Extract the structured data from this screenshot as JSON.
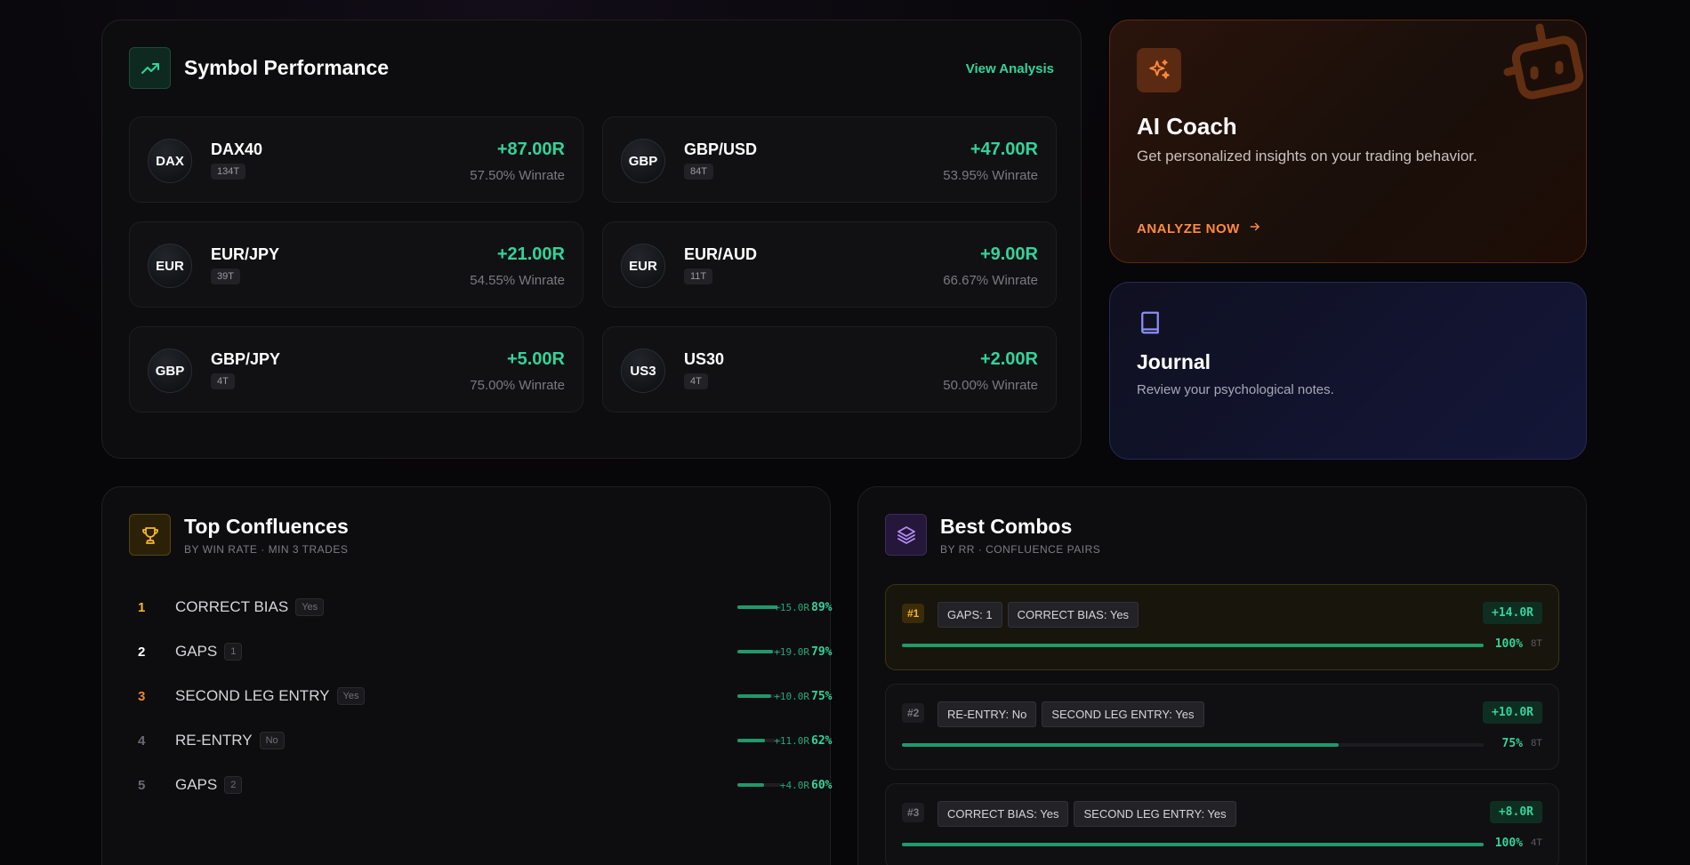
{
  "symbol_performance": {
    "title": "Symbol Performance",
    "view_link": "View Analysis",
    "symbols": [
      {
        "badge": "DAX",
        "name": "DAX40",
        "trades": "134T",
        "r": "+87.00R",
        "winrate": "57.50% Winrate"
      },
      {
        "badge": "GBP",
        "name": "GBP/USD",
        "trades": "84T",
        "r": "+47.00R",
        "winrate": "53.95% Winrate"
      },
      {
        "badge": "EUR",
        "name": "EUR/JPY",
        "trades": "39T",
        "r": "+21.00R",
        "winrate": "54.55% Winrate"
      },
      {
        "badge": "EUR",
        "name": "EUR/AUD",
        "trades": "11T",
        "r": "+9.00R",
        "winrate": "66.67% Winrate"
      },
      {
        "badge": "GBP",
        "name": "GBP/JPY",
        "trades": "4T",
        "r": "+5.00R",
        "winrate": "75.00% Winrate"
      },
      {
        "badge": "US3",
        "name": "US30",
        "trades": "4T",
        "r": "+2.00R",
        "winrate": "50.00% Winrate"
      }
    ]
  },
  "ai_coach": {
    "title": "AI Coach",
    "description": "Get personalized insights on your trading behavior.",
    "cta": "ANALYZE NOW",
    "accent": "#ff8a3d"
  },
  "journal": {
    "title": "Journal",
    "description": "Review your psychological notes."
  },
  "top_confluences": {
    "title": "Top Confluences",
    "subtitle": "BY WIN RATE · MIN 3 TRADES",
    "rows": [
      {
        "rank": "1",
        "rank_color": "#f5b52a",
        "name": "CORRECT BIAS",
        "tag": "Yes",
        "fill": 0.89,
        "pct": "89%",
        "r": "+15.0R"
      },
      {
        "rank": "2",
        "rank_color": "#ffffff",
        "name": "GAPS",
        "tag": "1",
        "fill": 0.79,
        "pct": "79%",
        "r": "+19.0R"
      },
      {
        "rank": "3",
        "rank_color": "#e8843a",
        "name": "SECOND LEG ENTRY",
        "tag": "Yes",
        "fill": 0.75,
        "pct": "75%",
        "r": "+10.0R"
      },
      {
        "rank": "4",
        "rank_color": "#6a6a72",
        "name": "RE-ENTRY",
        "tag": "No",
        "fill": 0.62,
        "pct": "62%",
        "r": "+11.0R"
      },
      {
        "rank": "5",
        "rank_color": "#6a6a72",
        "name": "GAPS",
        "tag": "2",
        "fill": 0.6,
        "pct": "60%",
        "r": "+4.0R"
      }
    ]
  },
  "best_combos": {
    "title": "Best Combos",
    "subtitle": "BY RR · CONFLUENCE PAIRS",
    "combos": [
      {
        "rank": "#1",
        "tags": [
          "GAPS: 1",
          "CORRECT BIAS: Yes"
        ],
        "r": "+14.0R",
        "fill": 1.0,
        "pct": "100%",
        "trades": "8T"
      },
      {
        "rank": "#2",
        "tags": [
          "RE-ENTRY: No",
          "SECOND LEG ENTRY: Yes"
        ],
        "r": "+10.0R",
        "fill": 0.75,
        "pct": "75%",
        "trades": "8T"
      },
      {
        "rank": "#3",
        "tags": [
          "CORRECT BIAS: Yes",
          "SECOND LEG ENTRY: Yes"
        ],
        "r": "+8.0R",
        "fill": 1.0,
        "pct": "100%",
        "trades": "4T"
      }
    ]
  },
  "colors": {
    "positive": "#34d399",
    "bar": "#1f9a6a"
  }
}
